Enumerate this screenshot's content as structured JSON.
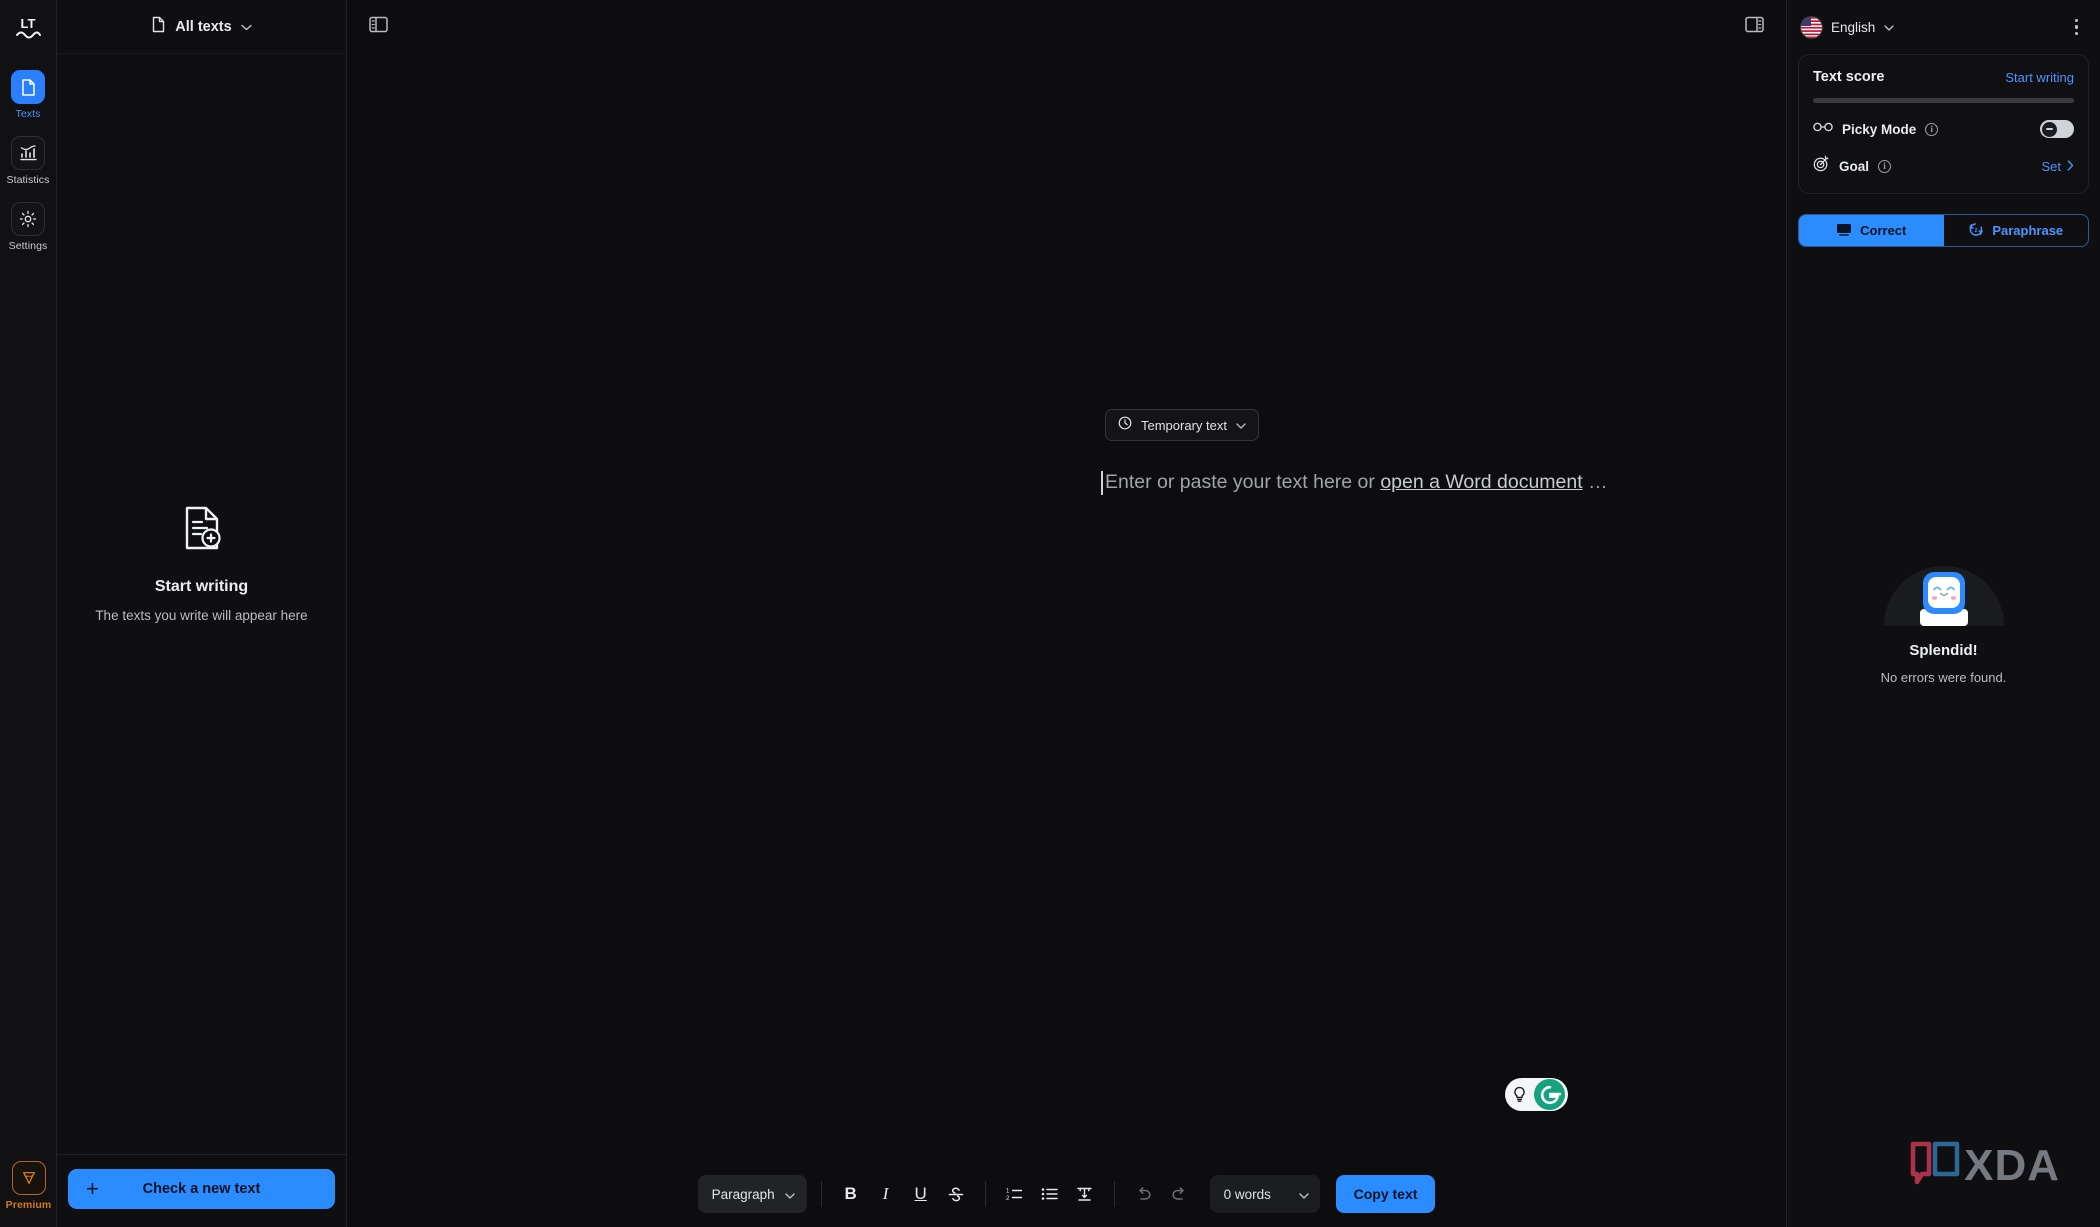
{
  "rail": {
    "logo_name": "languagetool-logo",
    "items": [
      {
        "label": "Texts",
        "icon": "document-icon",
        "active": true
      },
      {
        "label": "Statistics",
        "icon": "bar-chart-icon",
        "active": false
      },
      {
        "label": "Settings",
        "icon": "gear-icon",
        "active": false
      }
    ],
    "premium": {
      "label": "Premium",
      "icon": "gem-icon"
    }
  },
  "texts_panel": {
    "header": {
      "label": "All texts",
      "icon": "document-icon",
      "chevron": "chevron-down-icon"
    },
    "empty": {
      "title": "Start writing",
      "subtitle": "The texts you write will appear here",
      "icon": "document-add-icon"
    },
    "footer": {
      "button_label": "Check a new text",
      "icon": "plus-icon"
    }
  },
  "editor": {
    "left_panel_toggle": "panel-left-icon",
    "right_panel_toggle": "panel-right-icon",
    "chip": {
      "label": "Temporary text",
      "icon": "clock-icon",
      "chevron": "chevron-down-icon"
    },
    "placeholder": {
      "before": "Enter or paste your text here or ",
      "link": "open a Word document",
      "after": " …"
    }
  },
  "toolbar": {
    "block_format": "Paragraph",
    "bold": "B",
    "italic": "I",
    "underline": "U",
    "strikethrough": "S",
    "numbered_list": "numbered-list-icon",
    "bullet_list": "bullet-list-icon",
    "clear_format": "clear-format-icon",
    "undo": "undo-icon",
    "redo": "redo-icon",
    "word_count": "0 words",
    "copy_label": "Copy text"
  },
  "grammarly_widget": {
    "bulb_icon": "lightbulb-icon",
    "logo": "G"
  },
  "right_panel": {
    "language": {
      "name": "English",
      "flag": "us-flag-icon",
      "chevron": "chevron-down-icon"
    },
    "more_menu": "more-vertical-icon",
    "score": {
      "title": "Text score",
      "action": "Start writing",
      "progress": 0
    },
    "picky_mode": {
      "label": "Picky Mode",
      "icon": "glasses-icon",
      "info": "i",
      "enabled": false
    },
    "goal": {
      "label": "Goal",
      "icon": "target-icon",
      "info": "i",
      "action": "Set",
      "chevron": "chevron-right-icon"
    },
    "tabs": [
      {
        "label": "Correct",
        "icon": "monitor-icon",
        "active": true
      },
      {
        "label": "Paraphrase",
        "icon": "refresh-icon",
        "active": false
      }
    ],
    "result": {
      "title": "Splendid!",
      "subtitle": "No errors were found.",
      "mascot": "happy-robot-mascot"
    }
  },
  "watermark": {
    "text": "XDA",
    "logo": "xda-logo"
  },
  "colors": {
    "accent_blue": "#2a8cff",
    "link_blue": "#4d94ff",
    "premium_orange": "#d2791f",
    "grammarly_green": "#15a37f",
    "bg": "#0d0d0f"
  }
}
